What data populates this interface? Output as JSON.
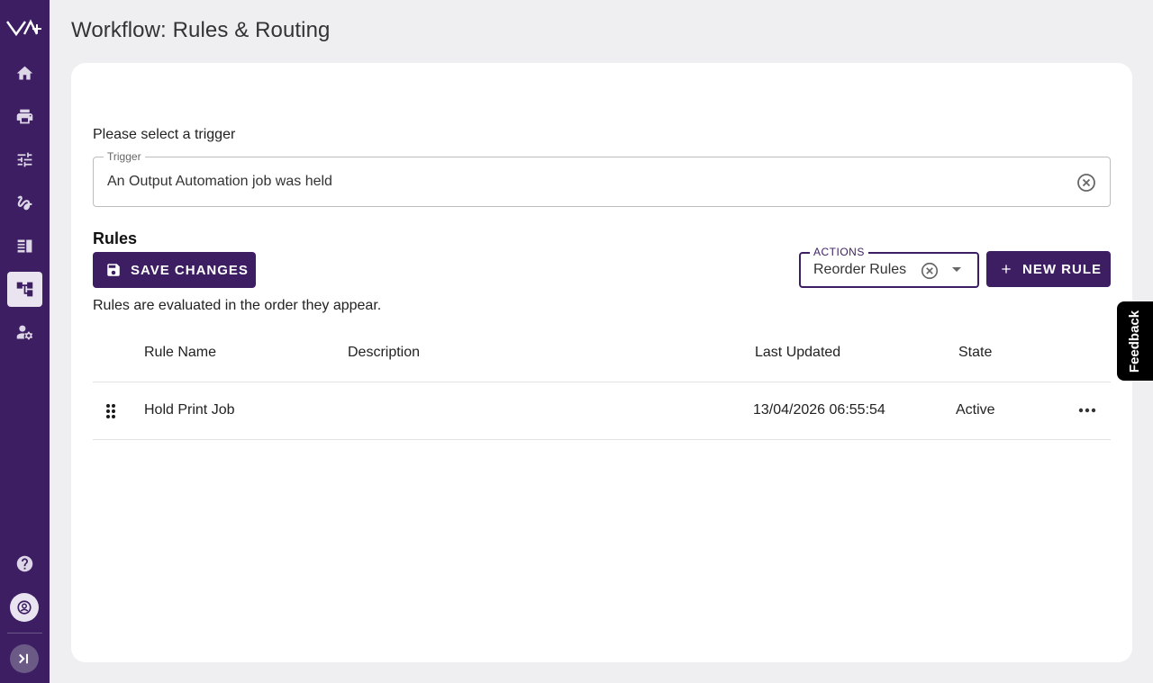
{
  "app": {
    "page_title": "Workflow: Rules & Routing"
  },
  "sidebar": {
    "logo": "VA+ logo",
    "items": [
      {
        "name": "home-icon",
        "active": false
      },
      {
        "name": "printer-icon",
        "active": false
      },
      {
        "name": "tune-icon",
        "active": false
      },
      {
        "name": "signature-icon",
        "active": false
      },
      {
        "name": "view-list-icon",
        "active": false
      },
      {
        "name": "workflow-tree-icon",
        "active": true
      },
      {
        "name": "user-settings-icon",
        "active": false
      }
    ],
    "bottom": [
      "help-icon",
      "account-icon",
      "expand-sidebar-icon"
    ]
  },
  "trigger": {
    "prompt": "Please select a trigger",
    "label": "Trigger",
    "value": "An Output Automation job was held"
  },
  "rules": {
    "heading": "Rules",
    "save_label": "SAVE CHANGES",
    "actions_label": "ACTIONS",
    "actions_value": "Reorder Rules",
    "new_rule_label": "NEW RULE",
    "note": "Rules are evaluated in the order they appear.",
    "columns": [
      "Rule Name",
      "Description",
      "Last Updated",
      "State"
    ],
    "rows": [
      {
        "name": "Hold Print Job",
        "description": "",
        "last_updated": "13/04/2026 06:55:54",
        "state": "Active"
      }
    ]
  },
  "feedback": {
    "label": "Feedback"
  },
  "colors": {
    "brand": "#3d1e63",
    "background": "#efeef1",
    "card": "#ffffff"
  }
}
